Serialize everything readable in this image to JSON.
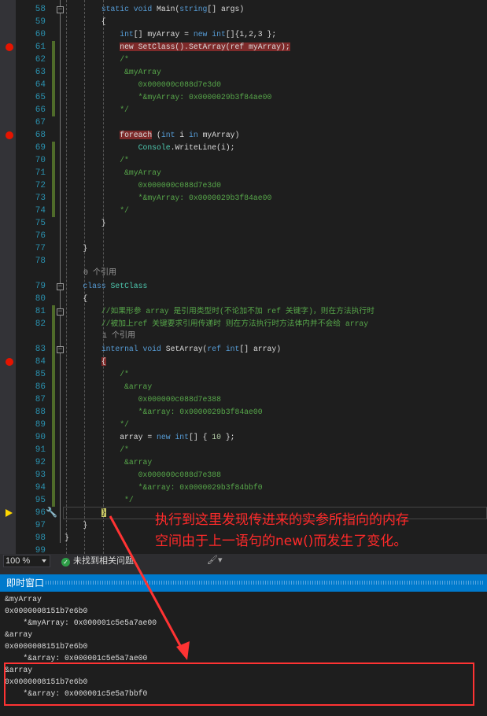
{
  "editor": {
    "lines": [
      {
        "n": "58",
        "fold": true,
        "t": [
          [
            "        ",
            "pl"
          ],
          [
            "static",
            "kw"
          ],
          [
            " ",
            "pl"
          ],
          [
            "void",
            "kw"
          ],
          [
            " Main(",
            "pl"
          ],
          [
            "string",
            "kw"
          ],
          [
            "[] args)",
            "pl"
          ]
        ]
      },
      {
        "n": "59",
        "t": [
          [
            "        {",
            "pl"
          ]
        ]
      },
      {
        "n": "60",
        "t": [
          [
            "            ",
            "pl"
          ],
          [
            "int",
            "kw"
          ],
          [
            "[] myArray = ",
            "pl"
          ],
          [
            "new",
            "kw"
          ],
          [
            " ",
            "pl"
          ],
          [
            "int",
            "kw"
          ],
          [
            "[]{1,2,3 };",
            "pl"
          ]
        ]
      },
      {
        "n": "61",
        "bp": true,
        "chg": true,
        "t": [
          [
            "            ",
            "pl"
          ],
          [
            "new SetClass().SetArray(ref myArray);",
            "pl hl"
          ]
        ]
      },
      {
        "n": "62",
        "chg": true,
        "t": [
          [
            "            /*",
            "cm"
          ]
        ]
      },
      {
        "n": "63",
        "chg": true,
        "t": [
          [
            "             &myArray",
            "cm"
          ]
        ]
      },
      {
        "n": "64",
        "chg": true,
        "t": [
          [
            "                0x000000c088d7e3d0",
            "cm"
          ]
        ]
      },
      {
        "n": "65",
        "chg": true,
        "t": [
          [
            "                *&myArray: 0x0000029b3f84ae00",
            "cm"
          ]
        ]
      },
      {
        "n": "66",
        "chg": true,
        "t": [
          [
            "            */",
            "cm"
          ]
        ]
      },
      {
        "n": "67",
        "t": []
      },
      {
        "n": "68",
        "bp": true,
        "t": [
          [
            "            ",
            "pl"
          ],
          [
            "foreach",
            "pl hl"
          ],
          [
            " (",
            "pl"
          ],
          [
            "int",
            "kw"
          ],
          [
            " i ",
            "pl"
          ],
          [
            "in",
            "kw"
          ],
          [
            " myArray)",
            "pl"
          ]
        ]
      },
      {
        "n": "69",
        "chg": true,
        "t": [
          [
            "                ",
            "pl"
          ],
          [
            "Console",
            "type"
          ],
          [
            ".WriteLine(i);",
            "pl"
          ]
        ]
      },
      {
        "n": "70",
        "chg": true,
        "t": [
          [
            "            /*",
            "cm"
          ]
        ]
      },
      {
        "n": "71",
        "chg": true,
        "t": [
          [
            "             &myArray",
            "cm"
          ]
        ]
      },
      {
        "n": "72",
        "chg": true,
        "t": [
          [
            "                0x000000c088d7e3d0",
            "cm"
          ]
        ]
      },
      {
        "n": "73",
        "chg": true,
        "t": [
          [
            "                *&myArray: 0x0000029b3f84ae00",
            "cm"
          ]
        ]
      },
      {
        "n": "74",
        "chg": true,
        "t": [
          [
            "            */",
            "cm"
          ]
        ]
      },
      {
        "n": "75",
        "t": [
          [
            "        }",
            "pl"
          ]
        ]
      },
      {
        "n": "76",
        "t": []
      },
      {
        "n": "77",
        "t": [
          [
            "    }",
            "pl"
          ]
        ]
      },
      {
        "n": "78",
        "t": []
      },
      {
        "lens": "    0 个引用"
      },
      {
        "n": "79",
        "fold": true,
        "t": [
          [
            "    ",
            "pl"
          ],
          [
            "class",
            "kw"
          ],
          [
            " ",
            "pl"
          ],
          [
            "SetClass",
            "type"
          ]
        ]
      },
      {
        "n": "80",
        "t": [
          [
            "    {",
            "pl"
          ]
        ]
      },
      {
        "n": "81",
        "fold": true,
        "chg": true,
        "t": [
          [
            "        //如果形参 array 是引用类型时(不论加不加 ref 关键字)，则在方法执行时",
            "cm"
          ]
        ]
      },
      {
        "n": "82",
        "chg": true,
        "t": [
          [
            "        //被加上ref 关键要求引用传递时 则在方法执行时方法体内并不会给 array",
            "cm"
          ]
        ]
      },
      {
        "lens": "        1 个引用",
        "chg": true
      },
      {
        "n": "83",
        "fold": true,
        "chg": true,
        "t": [
          [
            "        ",
            "pl"
          ],
          [
            "internal",
            "kw"
          ],
          [
            " ",
            "pl"
          ],
          [
            "void",
            "kw"
          ],
          [
            " SetArray(",
            "pl"
          ],
          [
            "ref",
            "kw"
          ],
          [
            " ",
            "pl"
          ],
          [
            "int",
            "kw"
          ],
          [
            "[] array)",
            "pl"
          ]
        ]
      },
      {
        "n": "84",
        "bp": true,
        "chg": true,
        "t": [
          [
            "        ",
            "pl"
          ],
          [
            "{",
            "pl hl"
          ]
        ]
      },
      {
        "n": "85",
        "chg": true,
        "t": [
          [
            "            /*",
            "cm"
          ]
        ]
      },
      {
        "n": "86",
        "chg": true,
        "t": [
          [
            "             &array",
            "cm"
          ]
        ]
      },
      {
        "n": "87",
        "chg": true,
        "t": [
          [
            "                0x000000c088d7e388",
            "cm"
          ]
        ]
      },
      {
        "n": "88",
        "chg": true,
        "t": [
          [
            "                *&array: 0x0000029b3f84ae00",
            "cm"
          ]
        ]
      },
      {
        "n": "89",
        "chg": true,
        "t": [
          [
            "            */",
            "cm"
          ]
        ]
      },
      {
        "n": "90",
        "chg": true,
        "t": [
          [
            "            array = ",
            "pl"
          ],
          [
            "new",
            "kw"
          ],
          [
            " ",
            "pl"
          ],
          [
            "int",
            "kw"
          ],
          [
            "[] { ",
            "pl"
          ],
          [
            "10",
            "num"
          ],
          [
            " };",
            "pl"
          ]
        ]
      },
      {
        "n": "91",
        "chg": true,
        "t": [
          [
            "            /*",
            "cm"
          ]
        ]
      },
      {
        "n": "92",
        "chg": true,
        "t": [
          [
            "             &array",
            "cm"
          ]
        ]
      },
      {
        "n": "93",
        "chg": true,
        "t": [
          [
            "                0x000000c088d7e388",
            "cm"
          ]
        ]
      },
      {
        "n": "94",
        "chg": true,
        "t": [
          [
            "                *&array: 0x0000029b3f84bbf0",
            "cm"
          ]
        ]
      },
      {
        "n": "95",
        "chg": true,
        "t": [
          [
            "             */",
            "cm"
          ]
        ]
      },
      {
        "n": "96",
        "exec": true,
        "t": [
          [
            "        ",
            "pl"
          ],
          [
            "}",
            "pl cur"
          ]
        ]
      },
      {
        "n": "97",
        "t": [
          [
            "    }",
            "pl"
          ]
        ]
      },
      {
        "n": "98",
        "t": [
          [
            "}",
            "pl"
          ]
        ]
      },
      {
        "n": "99",
        "t": []
      }
    ]
  },
  "annotation": {
    "line1": "执行到这里发现传进来的实参所指向的内存",
    "line2": "空间由于上一语句的new()而发生了变化。",
    "color": "#ff2a2a"
  },
  "status": {
    "zoom": "100 %",
    "issues": "未找到相关问题"
  },
  "immediate": {
    "title": "即时窗口",
    "lines": [
      "&myArray",
      "0x0000008151b7e6b0",
      "    *&myArray: 0x000001c5e5a7ae00",
      "&array",
      "0x0000008151b7e6b0",
      "    *&array: 0x000001c5e5a7ae00",
      "&array",
      "0x0000008151b7e6b0",
      "    *&array: 0x000001c5e5a7bbf0"
    ]
  },
  "colors": {
    "accent": "#007acc",
    "breakpoint": "#e51400",
    "keyword": "#569cd6",
    "type": "#4ec9b0",
    "comment": "#57a64a"
  }
}
